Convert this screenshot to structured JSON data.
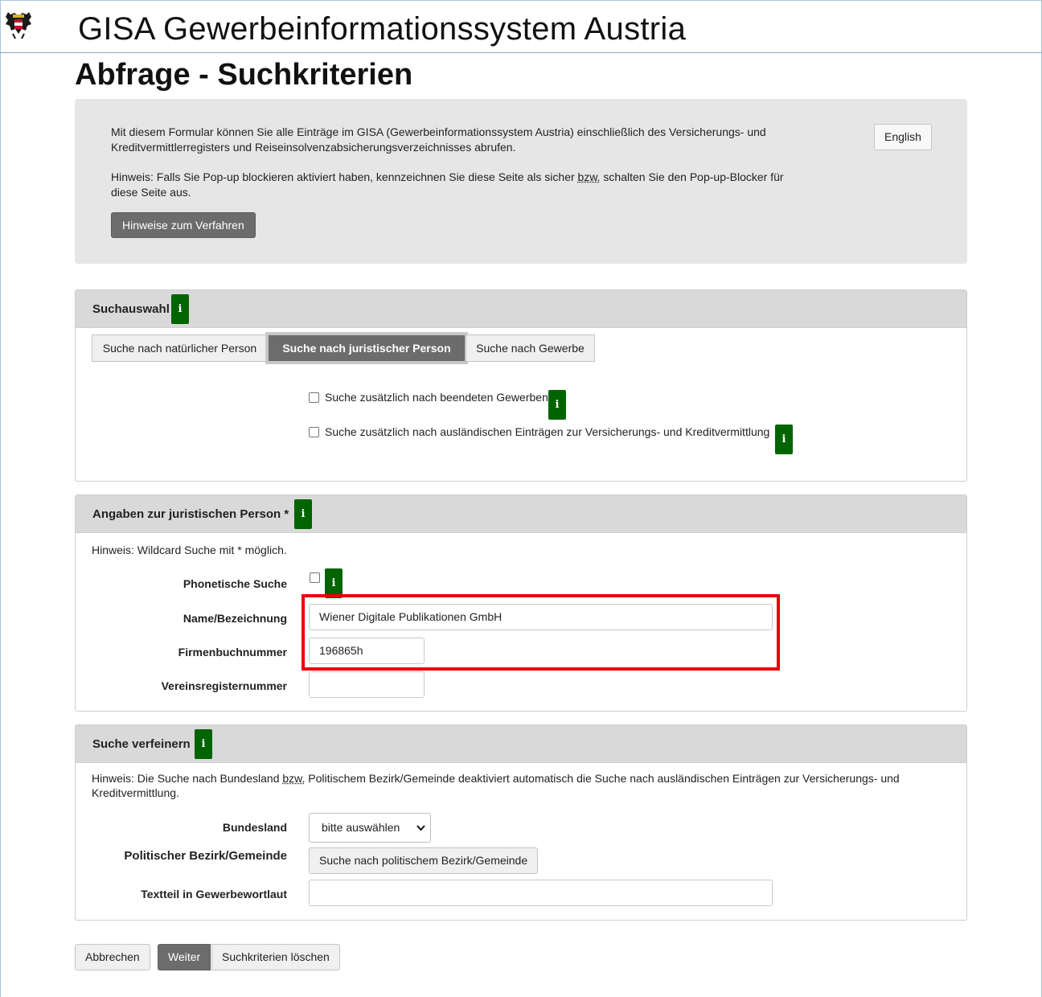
{
  "header": {
    "app_title": "GISA Gewerbeinformationssystem Austria",
    "page_title": "Abfrage - Suchkriterien"
  },
  "intro": {
    "text1": "Mit diesem Formular können Sie alle Einträge im GISA (Gewerbeinformationssystem Austria) einschließlich des Versicherungs- und Kreditvermittlerregisters und Reiseinsolvenzabsicherungsverzeichnisses abrufen.",
    "text2_a": "Hinweis: Falls Sie Pop-up blockieren aktiviert haben, kennzeichnen Sie diese Seite als sicher ",
    "text2_abbr": "bzw.",
    "text2_b": " schalten Sie den Pop-up-Blocker für diese Seite aus.",
    "hinweise_button": "Hinweise zum Verfahren",
    "english_button": "English"
  },
  "info_glyph": "i",
  "suchauswahl": {
    "title": "Suchauswahl",
    "tabs": [
      "Suche nach natürlicher Person",
      "Suche nach juristischer Person",
      "Suche nach Gewerbe"
    ],
    "active_tab": 1,
    "check_beendete": "Suche zusätzlich nach beendeten Gewerben",
    "check_auslaendisch": "Suche zusätzlich nach ausländischen Einträgen zur Versicherungs- und Kreditvermittlung"
  },
  "juristisch": {
    "title": "Angaben zur juristischen Person *",
    "hint": "Hinweis: Wildcard Suche mit * möglich.",
    "phonetisch_label": "Phonetische Suche",
    "name_label": "Name/Bezeichnung",
    "name_value": "Wiener Digitale Publikationen GmbH",
    "fb_label": "Firmenbuchnummer",
    "fb_value": "196865h",
    "vr_label": "Vereinsregisternummer",
    "vr_value": ""
  },
  "verfeinern": {
    "title": "Suche verfeinern",
    "hint_a": "Hinweis: Die Suche nach Bundesland ",
    "hint_abbr": "bzw.",
    "hint_b": " Politischem Bezirk/Gemeinde deaktiviert automatisch die Suche nach ausländischen Einträgen zur Versicherungs- und Kreditvermittlung.",
    "bundesland_label": "Bundesland",
    "bundesland_value": "bitte auswählen",
    "bezirk_label": "Politischer Bezirk/Gemeinde",
    "bezirk_button": "Suche nach politischem Bezirk/Gemeinde",
    "textteil_label": "Textteil in Gewerbewortlaut",
    "textteil_value": ""
  },
  "footer": {
    "abbrechen": "Abbrechen",
    "weiter": "Weiter",
    "loeschen": "Suchkriterien löschen"
  },
  "colors": {
    "info_badge": "#006400",
    "active_tab": "#6c6c6c",
    "panel_header": "#d9d9d9",
    "intro_bg": "#e6e6e6",
    "highlight": "#e8000b"
  }
}
